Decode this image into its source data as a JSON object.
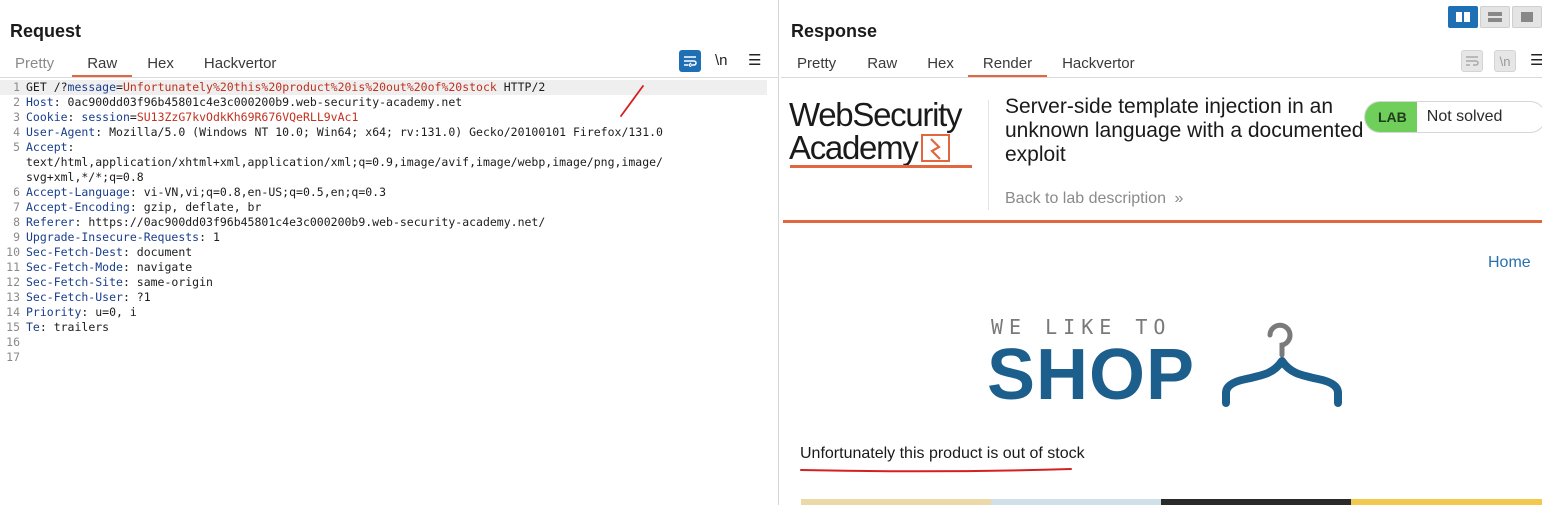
{
  "request": {
    "title": "Request",
    "tabs": [
      {
        "label": "Pretty",
        "state": "muted"
      },
      {
        "label": "Raw",
        "state": "active"
      },
      {
        "label": "Hex",
        "state": "normal"
      },
      {
        "label": "Hackvertor",
        "state": "normal"
      }
    ],
    "newline_label": "\\n",
    "menu_glyph": "☰",
    "lines": [
      {
        "n": "1",
        "parts": [
          [
            "GET /?",
            ""
          ],
          [
            "message",
            "blue"
          ],
          [
            "=",
            ""
          ],
          [
            "Unfortunately%20this%20product%20is%20out%20of%20stock",
            "red"
          ],
          [
            " HTTP/2",
            ""
          ]
        ]
      },
      {
        "n": "2",
        "parts": [
          [
            "Host",
            "blue"
          ],
          [
            ": 0ac900dd03f96b45801c4e3c000200b9.web-security-academy.net",
            ""
          ]
        ]
      },
      {
        "n": "3",
        "parts": [
          [
            "Cookie",
            "blue"
          ],
          [
            ": ",
            ""
          ],
          [
            "session",
            "blue"
          ],
          [
            "=",
            ""
          ],
          [
            "SU13ZzG7kvOdkKh69R676VQeRLL9vAc1",
            "red"
          ]
        ]
      },
      {
        "n": "4",
        "parts": [
          [
            "User-Agent",
            "blue"
          ],
          [
            ": Mozilla/5.0 (Windows NT 10.0; Win64; x64; rv:131.0) Gecko/20100101 Firefox/131.0",
            ""
          ]
        ]
      },
      {
        "n": "5",
        "parts": [
          [
            "Accept",
            "blue"
          ],
          [
            ":",
            ""
          ]
        ]
      },
      {
        "n": "",
        "parts": [
          [
            "text/html,application/xhtml+xml,application/xml;q=0.9,image/avif,image/webp,image/png,image/",
            ""
          ]
        ]
      },
      {
        "n": "",
        "parts": [
          [
            "svg+xml,*/*;q=0.8",
            ""
          ]
        ]
      },
      {
        "n": "6",
        "parts": [
          [
            "Accept-Language",
            "blue"
          ],
          [
            ": vi-VN,vi;q=0.8,en-US;q=0.5,en;q=0.3",
            ""
          ]
        ]
      },
      {
        "n": "7",
        "parts": [
          [
            "Accept-Encoding",
            "blue"
          ],
          [
            ": gzip, deflate, br",
            ""
          ]
        ]
      },
      {
        "n": "8",
        "parts": [
          [
            "Referer",
            "blue"
          ],
          [
            ": https://0ac900dd03f96b45801c4e3c000200b9.web-security-academy.net/",
            ""
          ]
        ]
      },
      {
        "n": "9",
        "parts": [
          [
            "Upgrade-Insecure-Requests",
            "blue"
          ],
          [
            ": 1",
            ""
          ]
        ]
      },
      {
        "n": "10",
        "parts": [
          [
            "Sec-Fetch-Dest",
            "blue"
          ],
          [
            ": document",
            ""
          ]
        ]
      },
      {
        "n": "11",
        "parts": [
          [
            "Sec-Fetch-Mode",
            "blue"
          ],
          [
            ": navigate",
            ""
          ]
        ]
      },
      {
        "n": "12",
        "parts": [
          [
            "Sec-Fetch-Site",
            "blue"
          ],
          [
            ": same-origin",
            ""
          ]
        ]
      },
      {
        "n": "13",
        "parts": [
          [
            "Sec-Fetch-User",
            "blue"
          ],
          [
            ": ?1",
            ""
          ]
        ]
      },
      {
        "n": "14",
        "parts": [
          [
            "Priority",
            "blue"
          ],
          [
            ": u=0, i",
            ""
          ]
        ]
      },
      {
        "n": "15",
        "parts": [
          [
            "Te",
            "blue"
          ],
          [
            ": trailers",
            ""
          ]
        ]
      },
      {
        "n": "16",
        "parts": [
          [
            "",
            ""
          ]
        ]
      },
      {
        "n": "17",
        "parts": [
          [
            "",
            ""
          ]
        ]
      }
    ]
  },
  "response": {
    "title": "Response",
    "tabs": [
      {
        "label": "Pretty",
        "state": "normal"
      },
      {
        "label": "Raw",
        "state": "normal"
      },
      {
        "label": "Hex",
        "state": "normal"
      },
      {
        "label": "Render",
        "state": "active"
      },
      {
        "label": "Hackvertor",
        "state": "normal"
      }
    ],
    "newline_label": "\\n",
    "render": {
      "logo_line1": "WebSecurity",
      "logo_line2": "Academy",
      "lab_title": "Server-side template injection in an unknown language with a documented exploit",
      "back_link": "Back to lab description",
      "back_chevron": "»",
      "lab_badge": "LAB",
      "lab_state": "Not solved",
      "home_link": "Home",
      "shop_tagline": "WE LIKE TO",
      "shop_word": "SHOP",
      "message": "Unfortunately this product is out of stock"
    }
  },
  "colors": {
    "accent_orange": "#e2673f",
    "burp_blue": "#1f6fb5",
    "shop_blue": "#1d5f8c",
    "lab_green": "#6fcf5a",
    "annotation_red": "#d62020"
  }
}
